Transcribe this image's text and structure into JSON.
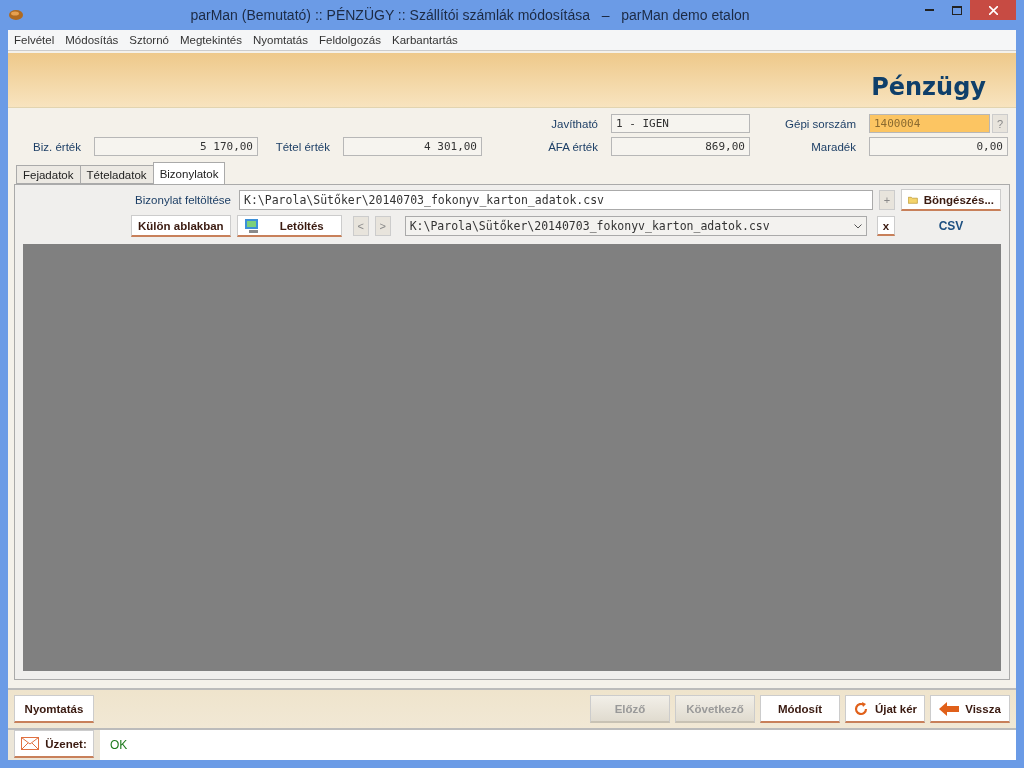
{
  "window": {
    "title": "parMan (Bemutató) :: PÉNZÜGY :: Szállítói számlák módosítása   –   parMan demo etalon"
  },
  "menu": [
    "Felvétel",
    "Módosítás",
    "Sztornó",
    "Megtekintés",
    "Nyomtatás",
    "Feldolgozás",
    "Karbantartás"
  ],
  "header": {
    "title": "Pénzügy"
  },
  "fields_top": [
    {
      "label": "Javítható",
      "value": "1 - IGEN",
      "kind": "text"
    },
    {
      "label": "Gépi sorszám",
      "value": "1400004",
      "kind": "lookup",
      "help": "?"
    }
  ],
  "fields": [
    {
      "label": "Biz. érték",
      "value": "5 170,00"
    },
    {
      "label": "Tétel érték",
      "value": "4 301,00"
    },
    {
      "label": "ÁFA érték",
      "value": "869,00"
    },
    {
      "label": "Maradék",
      "value": "0,00"
    }
  ],
  "tabs": [
    {
      "label": "Fejadatok",
      "selected": false
    },
    {
      "label": "Tételadatok",
      "selected": false
    },
    {
      "label": "Bizonylatok",
      "selected": true
    }
  ],
  "upload": {
    "label": "Bizonylat feltöltése",
    "value": "K:\\Parola\\Sütőker\\20140703_fokonyv_karton_adatok.csv",
    "add": "+",
    "browse": "Böngészés..."
  },
  "toolbar": {
    "separate": "Külön ablakban",
    "download": "Letöltés",
    "prev": "<",
    "next": ">",
    "file": "K:\\Parola\\Sütőker\\20140703_fokonyv_karton_adatok.csv",
    "remove": "x",
    "type": "CSV"
  },
  "left_button": "Nyomtatás",
  "buttons": [
    {
      "label": "Előző",
      "disabled": true,
      "kind": "plain"
    },
    {
      "label": "Következő",
      "disabled": true,
      "kind": "plain"
    },
    {
      "label": "Módosít",
      "disabled": false,
      "kind": "plain"
    },
    {
      "label": "Újat kér",
      "disabled": false,
      "kind": "refresh"
    },
    {
      "label": "Vissza",
      "disabled": false,
      "kind": "back"
    }
  ],
  "message": {
    "label": "Üzenet:",
    "text": "OK"
  }
}
